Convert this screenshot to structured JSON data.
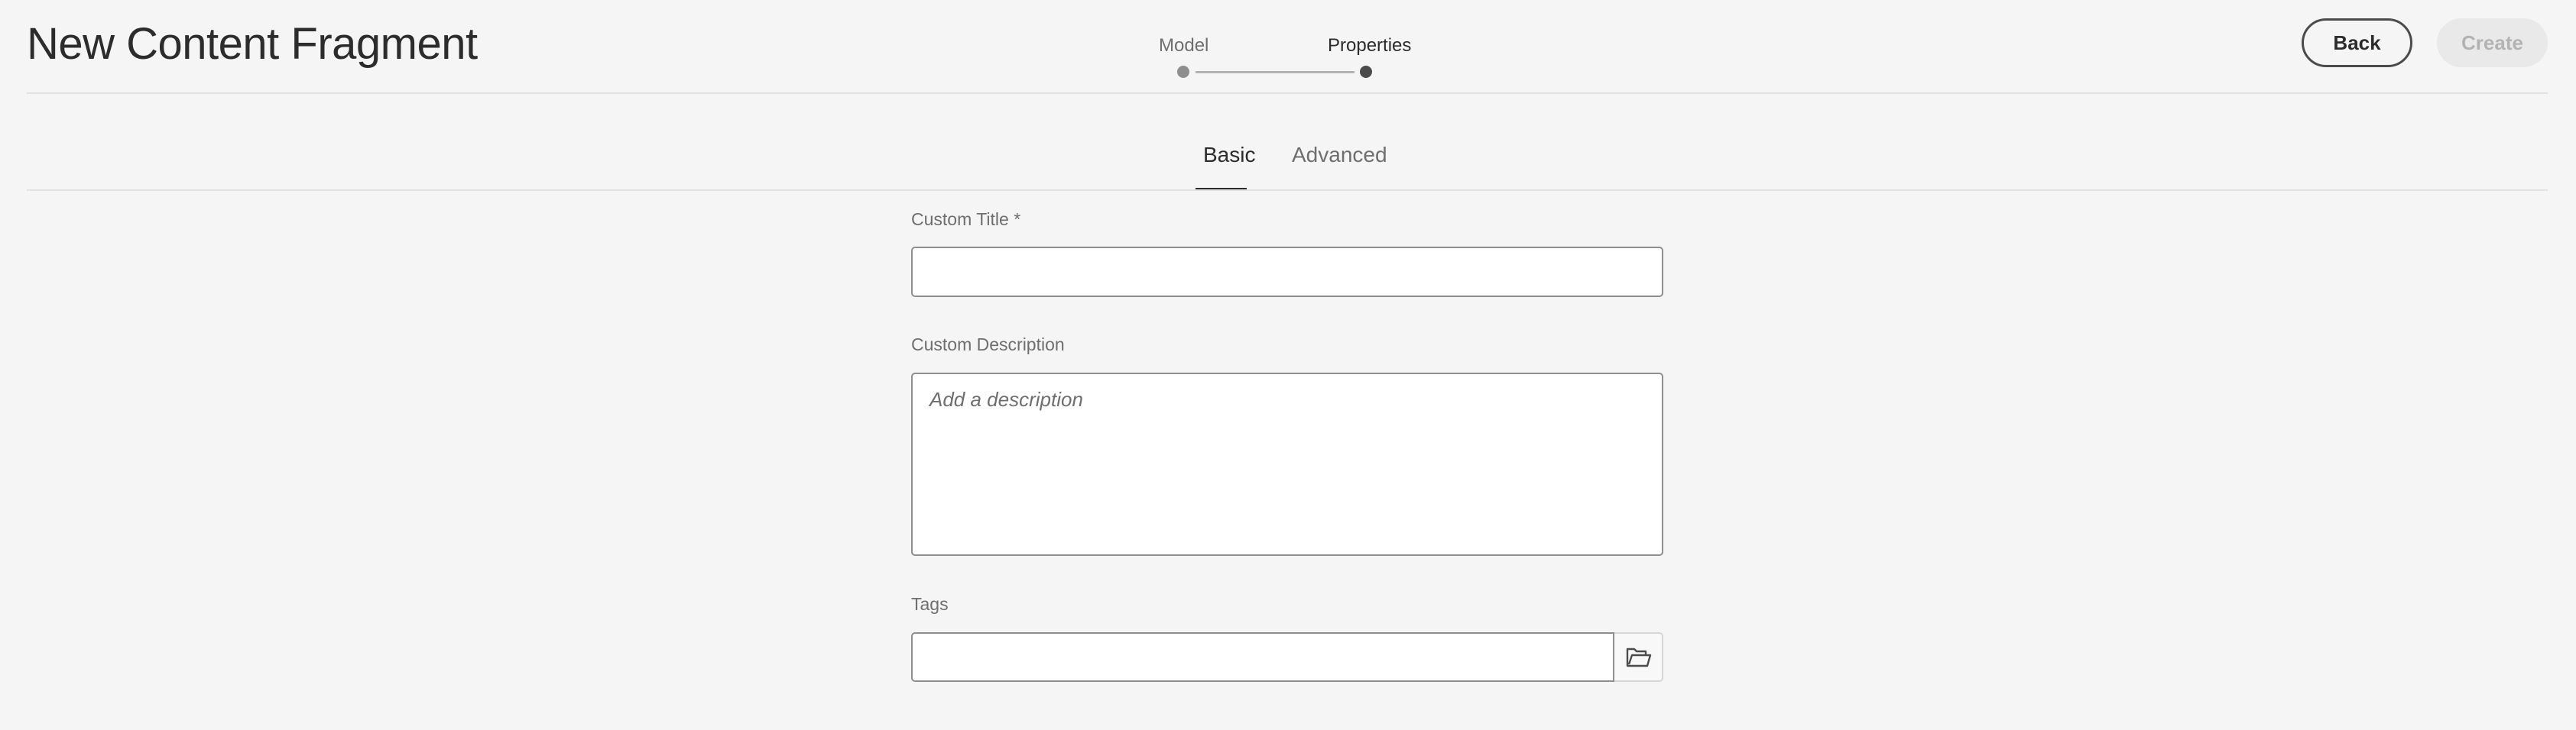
{
  "header": {
    "title": "New Content Fragment",
    "back_label": "Back",
    "create_label": "Create"
  },
  "wizard": {
    "steps": [
      {
        "label": "Model",
        "state": "completed"
      },
      {
        "label": "Properties",
        "state": "current"
      }
    ]
  },
  "tabs": {
    "items": [
      {
        "label": "Basic",
        "selected": true
      },
      {
        "label": "Advanced",
        "selected": false
      }
    ]
  },
  "form": {
    "title_label": "Custom Title *",
    "title_value": "",
    "description_label": "Custom Description",
    "description_placeholder": "Add a description",
    "tags_label": "Tags",
    "tags_value": "",
    "tags_picker_icon": "folder-open-icon"
  },
  "colors": {
    "background": "#f5f5f5",
    "text": "#2c2c2c",
    "muted_text": "#6e6e6e",
    "disabled_button": "#e9e9e9"
  }
}
